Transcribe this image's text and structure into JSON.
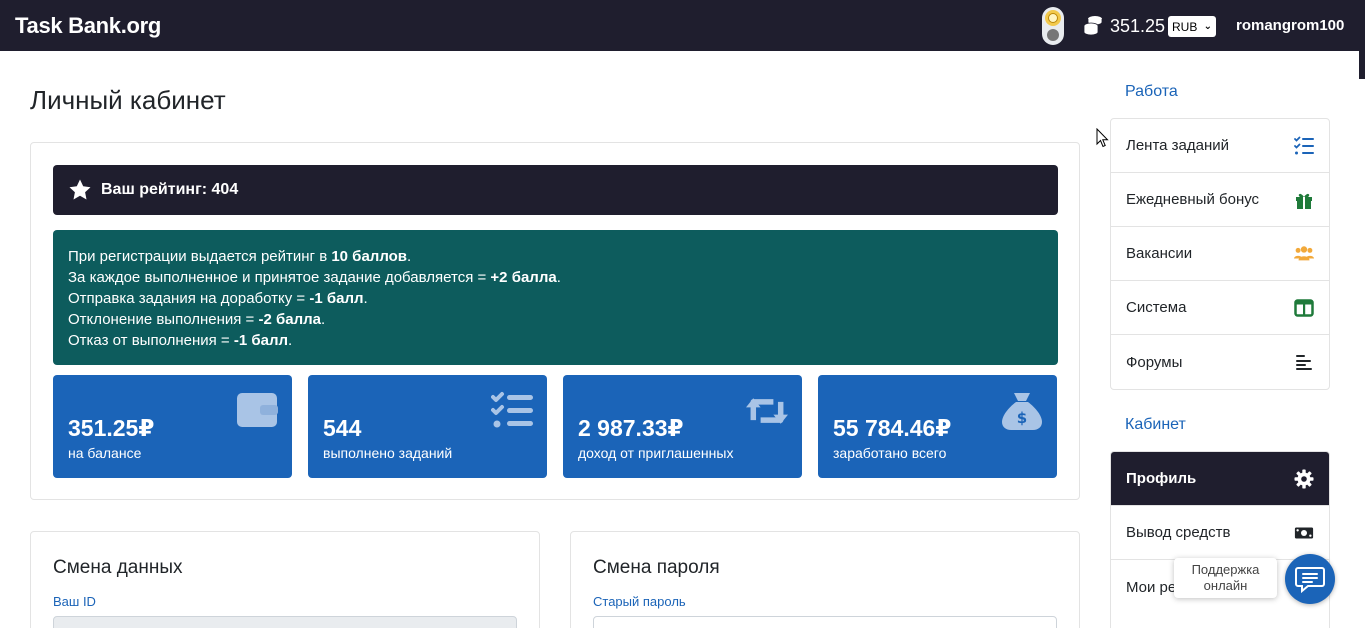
{
  "navbar": {
    "brand": "Task Bank.org",
    "balance": "351.25",
    "currency": "RUB",
    "username": "romangrom100"
  },
  "page_title": "Личный кабинет",
  "rating": {
    "text": "Ваш рейтинг: 404"
  },
  "info": {
    "line1_pre": "При регистрации выдается рейтинг в ",
    "line1_bold": "10 баллов",
    "line1_post": ".",
    "line2_pre": "За каждое выполненное и принятое задание добавляется = ",
    "line2_bold": "+2 балла",
    "line2_post": ".",
    "line3_pre": "Отправка задания на доработку = ",
    "line3_bold": "-1 балл",
    "line3_post": ".",
    "line4_pre": "Отклонение выполнения = ",
    "line4_bold": "-2 балла",
    "line4_post": ".",
    "line5_pre": "Отказ от выполнения = ",
    "line5_bold": "-1 балл",
    "line5_post": "."
  },
  "stats": [
    {
      "value": "351.25₽",
      "label": "на балансе",
      "icon": "wallet-icon"
    },
    {
      "value": "544",
      "label": "выполнено заданий",
      "icon": "task-list-icon"
    },
    {
      "value": "2 987.33₽",
      "label": "доход от приглашенных",
      "icon": "retweet-icon"
    },
    {
      "value": "55 784.46₽",
      "label": "заработано всего",
      "icon": "money-bag-icon"
    }
  ],
  "change_data": {
    "title": "Смена данных",
    "field_label": "Ваш ID"
  },
  "change_password": {
    "title": "Смена пароля",
    "field_label": "Старый пароль"
  },
  "sidebar": {
    "work_heading": "Работа",
    "work_items": [
      {
        "label": "Лента заданий",
        "icon": "task-list-icon"
      },
      {
        "label": "Ежедневный бонус",
        "icon": "gift-icon"
      },
      {
        "label": "Вакансии",
        "icon": "users-icon"
      },
      {
        "label": "Система",
        "icon": "columns-icon"
      },
      {
        "label": "Форумы",
        "icon": "align-left-icon"
      }
    ],
    "cabinet_heading": "Кабинет",
    "cabinet_items": [
      {
        "label": "Профиль",
        "icon": "gear-icon"
      },
      {
        "label": "Вывод средств",
        "icon": "money-bill-icon"
      },
      {
        "label": "Мои ре",
        "icon": ""
      }
    ]
  },
  "support": {
    "line1": "Поддержка",
    "line2": "онлайн"
  },
  "colors": {
    "navbar": "#1f1e2e",
    "info_box": "#0d5c5d",
    "stat_card": "#1b64b8",
    "link": "#1b64b8",
    "gift": "#1f7a3a",
    "users": "#f2a93b"
  }
}
